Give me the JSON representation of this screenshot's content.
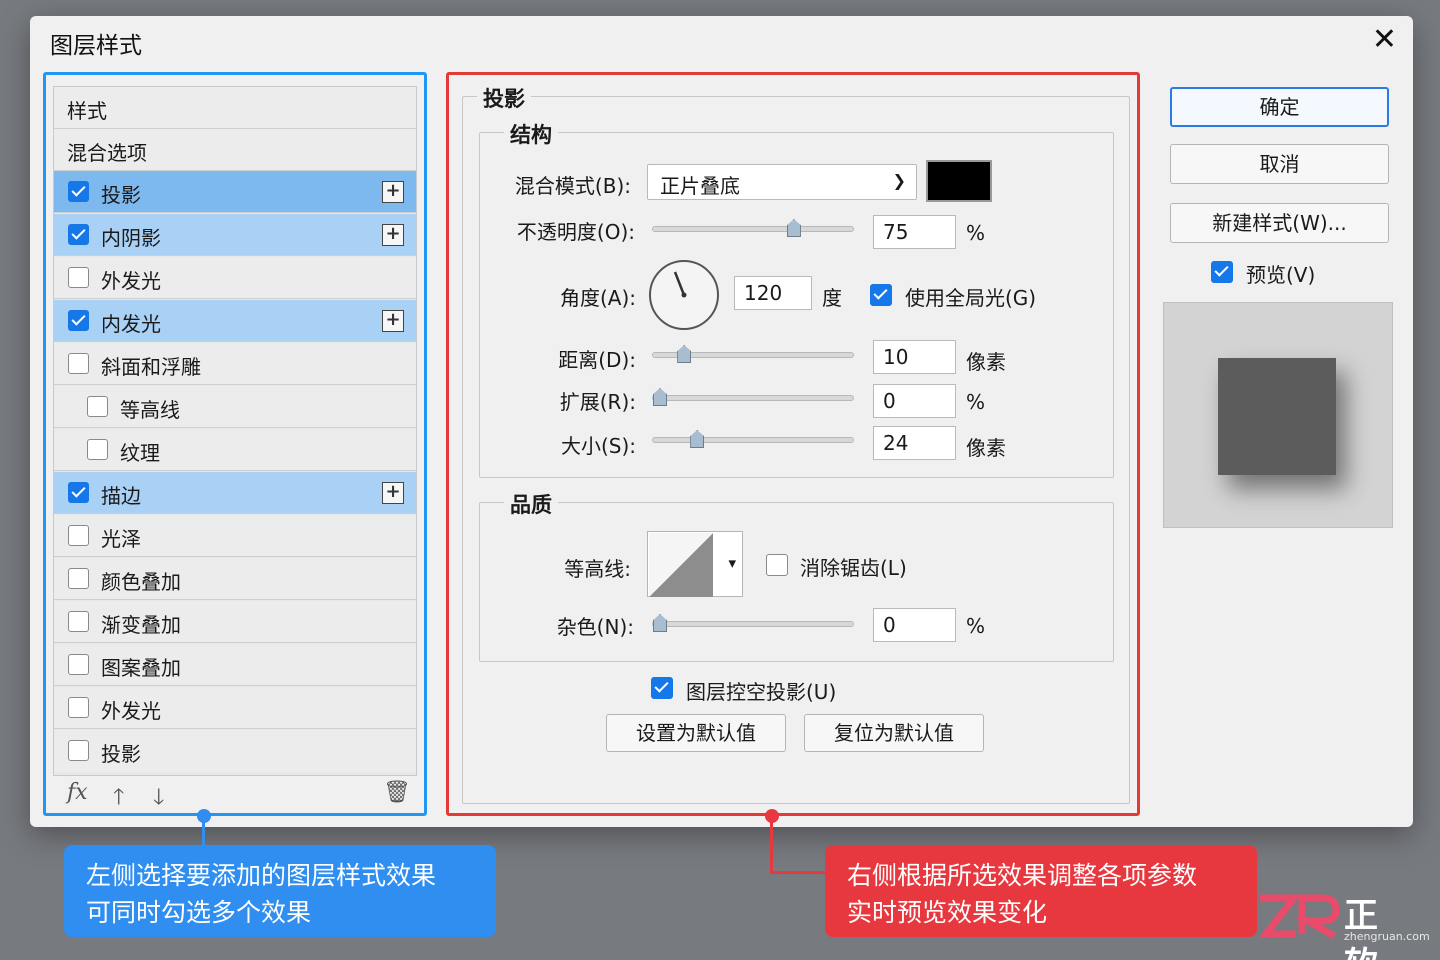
{
  "dialog": {
    "title": "图层样式"
  },
  "styles": {
    "header": "样式",
    "blending_options": "混合选项",
    "items": [
      {
        "label": "投影",
        "checked": true
      },
      {
        "label": "内阴影",
        "checked": true
      },
      {
        "label": "外发光",
        "checked": false
      },
      {
        "label": "内发光",
        "checked": true
      },
      {
        "label": "斜面和浮雕",
        "checked": false
      },
      {
        "label": "等高线",
        "checked": false
      },
      {
        "label": "纹理",
        "checked": false
      },
      {
        "label": "描边",
        "checked": true
      },
      {
        "label": "光泽",
        "checked": false
      },
      {
        "label": "颜色叠加",
        "checked": false
      },
      {
        "label": "渐变叠加",
        "checked": false
      },
      {
        "label": "图案叠加",
        "checked": false
      },
      {
        "label": "外发光",
        "checked": false
      },
      {
        "label": "投影",
        "checked": false
      }
    ],
    "footer": {
      "fx": "fx"
    }
  },
  "effect": {
    "title": "投影",
    "structure": {
      "title": "结构",
      "blend_mode_label": "混合模式(B):",
      "blend_mode_value": "正片叠底",
      "blend_color": "#000000",
      "opacity_label": "不透明度(O):",
      "opacity_value": "75",
      "opacity_unit": "%",
      "opacity_slider": 0.72,
      "angle_label": "角度(A):",
      "angle_value": "120",
      "angle_unit": "度",
      "global_light_label": "使用全局光(G)",
      "distance_label": "距离(D):",
      "distance_value": "10",
      "distance_unit": "像素",
      "distance_slider": 0.13,
      "spread_label": "扩展(R):",
      "spread_value": "0",
      "spread_unit": "%",
      "spread_slider": 0.0,
      "size_label": "大小(S):",
      "size_value": "24",
      "size_unit": "像素",
      "size_slider": 0.2
    },
    "quality": {
      "title": "品质",
      "contour_label": "等高线:",
      "anti_alias_label": "消除锯齿(L)",
      "noise_label": "杂色(N):",
      "noise_value": "0",
      "noise_unit": "%",
      "noise_slider": 0.0
    },
    "knockout_label": "图层控空投影(U)",
    "set_default": "设置为默认值",
    "reset_default": "复位为默认值"
  },
  "actions": {
    "ok": "确定",
    "cancel": "取消",
    "new_style": "新建样式(W)...",
    "preview_label": "预览(V)"
  },
  "callouts": {
    "left_line1": "左侧选择要添加的图层样式效果",
    "left_line2": "可同时勾选多个效果",
    "right_line1": "右侧根据所选效果调整各项参数",
    "right_line2": "实时预览效果变化"
  },
  "brand": {
    "name": "正软",
    "url": "zhengruan.com"
  },
  "colors": {
    "accent_blue": "#2f8ef0",
    "accent_red": "#e8383f",
    "selection": "#a9d1f6"
  }
}
